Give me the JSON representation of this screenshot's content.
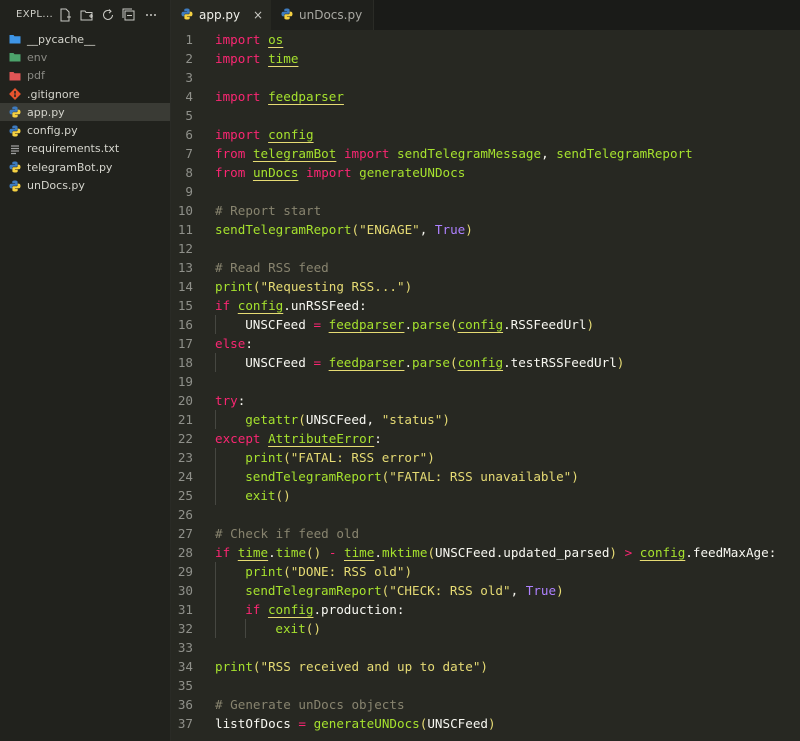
{
  "sidebar": {
    "title": "EXPL...",
    "items": [
      {
        "label": "__pycache__",
        "icon": "folder-icon",
        "color": "#3e95e6",
        "dim": false
      },
      {
        "label": "env",
        "icon": "folder-icon",
        "color": "#4ca36b",
        "dim": true
      },
      {
        "label": "pdf",
        "icon": "folder-icon",
        "color": "#e05555",
        "dim": true
      },
      {
        "label": ".gitignore",
        "icon": "git-icon",
        "color": "#e8542e",
        "dim": false
      },
      {
        "label": "app.py",
        "icon": "python-icon",
        "color": "#3b77a8",
        "dim": false,
        "active": true
      },
      {
        "label": "config.py",
        "icon": "python-icon",
        "color": "#3b77a8",
        "dim": false
      },
      {
        "label": "requirements.txt",
        "icon": "text-file-icon",
        "color": "#a0a0a0",
        "dim": false
      },
      {
        "label": "telegramBot.py",
        "icon": "python-icon",
        "color": "#3b77a8",
        "dim": false
      },
      {
        "label": "unDocs.py",
        "icon": "python-icon",
        "color": "#3b77a8",
        "dim": false
      }
    ]
  },
  "tabs": [
    {
      "label": "app.py",
      "active": true,
      "close": "×"
    },
    {
      "label": "unDocs.py",
      "active": false
    }
  ],
  "editor": {
    "lines": [
      {
        "n": "1",
        "indent": 0,
        "tokens": [
          [
            "kw",
            "import"
          ],
          [
            "pl",
            " "
          ],
          [
            "mod",
            "os"
          ]
        ]
      },
      {
        "n": "2",
        "indent": 0,
        "tokens": [
          [
            "kw",
            "import"
          ],
          [
            "pl",
            " "
          ],
          [
            "mod",
            "time"
          ]
        ]
      },
      {
        "n": "3",
        "indent": 0,
        "tokens": []
      },
      {
        "n": "4",
        "indent": 0,
        "tokens": [
          [
            "kw",
            "import"
          ],
          [
            "pl",
            " "
          ],
          [
            "mod",
            "feedparser"
          ]
        ]
      },
      {
        "n": "5",
        "indent": 0,
        "tokens": []
      },
      {
        "n": "6",
        "indent": 0,
        "tokens": [
          [
            "kw",
            "import"
          ],
          [
            "pl",
            " "
          ],
          [
            "mod",
            "config"
          ]
        ]
      },
      {
        "n": "7",
        "indent": 0,
        "tokens": [
          [
            "kw",
            "from"
          ],
          [
            "pl",
            " "
          ],
          [
            "mod",
            "telegramBot"
          ],
          [
            "pl",
            " "
          ],
          [
            "kw",
            "import"
          ],
          [
            "pl",
            " "
          ],
          [
            "fn",
            "sendTelegramMessage"
          ],
          [
            "pl",
            ", "
          ],
          [
            "fn",
            "sendTelegramReport"
          ]
        ]
      },
      {
        "n": "8",
        "indent": 0,
        "tokens": [
          [
            "kw",
            "from"
          ],
          [
            "pl",
            " "
          ],
          [
            "mod",
            "unDocs"
          ],
          [
            "pl",
            " "
          ],
          [
            "kw",
            "import"
          ],
          [
            "pl",
            " "
          ],
          [
            "fn",
            "generateUNDocs"
          ]
        ]
      },
      {
        "n": "9",
        "indent": 0,
        "tokens": []
      },
      {
        "n": "10",
        "indent": 0,
        "tokens": [
          [
            "cm",
            "# Report start"
          ]
        ]
      },
      {
        "n": "11",
        "indent": 0,
        "tokens": [
          [
            "fn",
            "sendTelegramReport"
          ],
          [
            "par",
            "("
          ],
          [
            "str",
            "\"ENGAGE\""
          ],
          [
            "pl",
            ", "
          ],
          [
            "const",
            "True"
          ],
          [
            "par",
            ")"
          ]
        ]
      },
      {
        "n": "12",
        "indent": 0,
        "tokens": []
      },
      {
        "n": "13",
        "indent": 0,
        "tokens": [
          [
            "cm",
            "# Read RSS feed"
          ]
        ]
      },
      {
        "n": "14",
        "indent": 0,
        "tokens": [
          [
            "fn",
            "print"
          ],
          [
            "par",
            "("
          ],
          [
            "str",
            "\"Requesting RSS...\""
          ],
          [
            "par",
            ")"
          ]
        ]
      },
      {
        "n": "15",
        "indent": 0,
        "tokens": [
          [
            "kw",
            "if"
          ],
          [
            "pl",
            " "
          ],
          [
            "mod",
            "config"
          ],
          [
            "pl",
            ".unRSSFeed:"
          ]
        ]
      },
      {
        "n": "16",
        "indent": 1,
        "tokens": [
          [
            "pl",
            "UNSCFeed "
          ],
          [
            "kw",
            "="
          ],
          [
            "pl",
            " "
          ],
          [
            "mod",
            "feedparser"
          ],
          [
            "pl",
            "."
          ],
          [
            "fn",
            "parse"
          ],
          [
            "par",
            "("
          ],
          [
            "mod",
            "config"
          ],
          [
            "pl",
            ".RSSFeedUrl"
          ],
          [
            "par",
            ")"
          ]
        ]
      },
      {
        "n": "17",
        "indent": 0,
        "tokens": [
          [
            "kw",
            "else"
          ],
          [
            "pl",
            ":"
          ]
        ]
      },
      {
        "n": "18",
        "indent": 1,
        "tokens": [
          [
            "pl",
            "UNSCFeed "
          ],
          [
            "kw",
            "="
          ],
          [
            "pl",
            " "
          ],
          [
            "mod",
            "feedparser"
          ],
          [
            "pl",
            "."
          ],
          [
            "fn",
            "parse"
          ],
          [
            "par",
            "("
          ],
          [
            "mod",
            "config"
          ],
          [
            "pl",
            ".testRSSFeedUrl"
          ],
          [
            "par",
            ")"
          ]
        ]
      },
      {
        "n": "19",
        "indent": 0,
        "tokens": []
      },
      {
        "n": "20",
        "indent": 0,
        "tokens": [
          [
            "kw",
            "try"
          ],
          [
            "pl",
            ":"
          ]
        ]
      },
      {
        "n": "21",
        "indent": 1,
        "tokens": [
          [
            "fn",
            "getattr"
          ],
          [
            "par",
            "("
          ],
          [
            "pl",
            "UNSCFeed, "
          ],
          [
            "str",
            "\"status\""
          ],
          [
            "par",
            ")"
          ]
        ]
      },
      {
        "n": "22",
        "indent": 0,
        "tokens": [
          [
            "kw",
            "except"
          ],
          [
            "pl",
            " "
          ],
          [
            "cls",
            "AttributeError"
          ],
          [
            "pl",
            ":"
          ]
        ]
      },
      {
        "n": "23",
        "indent": 1,
        "tokens": [
          [
            "fn",
            "print"
          ],
          [
            "par",
            "("
          ],
          [
            "str",
            "\"FATAL: RSS error\""
          ],
          [
            "par",
            ")"
          ]
        ]
      },
      {
        "n": "24",
        "indent": 1,
        "tokens": [
          [
            "fn",
            "sendTelegramReport"
          ],
          [
            "par",
            "("
          ],
          [
            "str",
            "\"FATAL: RSS unavailable\""
          ],
          [
            "par",
            ")"
          ]
        ]
      },
      {
        "n": "25",
        "indent": 1,
        "tokens": [
          [
            "fn",
            "exit"
          ],
          [
            "par",
            "()"
          ]
        ]
      },
      {
        "n": "26",
        "indent": 0,
        "tokens": []
      },
      {
        "n": "27",
        "indent": 0,
        "tokens": [
          [
            "cm",
            "# Check if feed old"
          ]
        ]
      },
      {
        "n": "28",
        "indent": 0,
        "tokens": [
          [
            "kw",
            "if"
          ],
          [
            "pl",
            " "
          ],
          [
            "mod",
            "time"
          ],
          [
            "pl",
            "."
          ],
          [
            "fn",
            "time"
          ],
          [
            "par",
            "()"
          ],
          [
            "pl",
            " "
          ],
          [
            "kw",
            "-"
          ],
          [
            "pl",
            " "
          ],
          [
            "mod",
            "time"
          ],
          [
            "pl",
            "."
          ],
          [
            "fn",
            "mktime"
          ],
          [
            "par",
            "("
          ],
          [
            "pl",
            "UNSCFeed.updated_parsed"
          ],
          [
            "par",
            ")"
          ],
          [
            "pl",
            " "
          ],
          [
            "kw",
            ">"
          ],
          [
            "pl",
            " "
          ],
          [
            "mod",
            "config"
          ],
          [
            "pl",
            ".feedMaxAge:"
          ]
        ]
      },
      {
        "n": "29",
        "indent": 1,
        "tokens": [
          [
            "fn",
            "print"
          ],
          [
            "par",
            "("
          ],
          [
            "str",
            "\"DONE: RSS old\""
          ],
          [
            "par",
            ")"
          ]
        ]
      },
      {
        "n": "30",
        "indent": 1,
        "tokens": [
          [
            "fn",
            "sendTelegramReport"
          ],
          [
            "par",
            "("
          ],
          [
            "str",
            "\"CHECK: RSS old\""
          ],
          [
            "pl",
            ", "
          ],
          [
            "const",
            "True"
          ],
          [
            "par",
            ")"
          ]
        ]
      },
      {
        "n": "31",
        "indent": 1,
        "tokens": [
          [
            "kw",
            "if"
          ],
          [
            "pl",
            " "
          ],
          [
            "mod",
            "config"
          ],
          [
            "pl",
            ".production:"
          ]
        ]
      },
      {
        "n": "32",
        "indent": 2,
        "tokens": [
          [
            "fn",
            "exit"
          ],
          [
            "par",
            "()"
          ]
        ]
      },
      {
        "n": "33",
        "indent": 0,
        "tokens": []
      },
      {
        "n": "34",
        "indent": 0,
        "tokens": [
          [
            "fn",
            "print"
          ],
          [
            "par",
            "("
          ],
          [
            "str",
            "\"RSS received and up to date\""
          ],
          [
            "par",
            ")"
          ]
        ]
      },
      {
        "n": "35",
        "indent": 0,
        "tokens": []
      },
      {
        "n": "36",
        "indent": 0,
        "tokens": [
          [
            "cm",
            "# Generate unDocs objects"
          ]
        ]
      },
      {
        "n": "37",
        "indent": 0,
        "tokens": [
          [
            "pl",
            "listOfDocs "
          ],
          [
            "kw",
            "="
          ],
          [
            "pl",
            " "
          ],
          [
            "fn",
            "generateUNDocs"
          ],
          [
            "par",
            "("
          ],
          [
            "pl",
            "UNSCFeed"
          ],
          [
            "par",
            ")"
          ]
        ]
      }
    ]
  },
  "colors": {
    "background": "#272822",
    "keyword": "#f92672",
    "function": "#a6e22e",
    "string": "#e6db74",
    "comment": "#88846f",
    "constant": "#ae81ff"
  }
}
